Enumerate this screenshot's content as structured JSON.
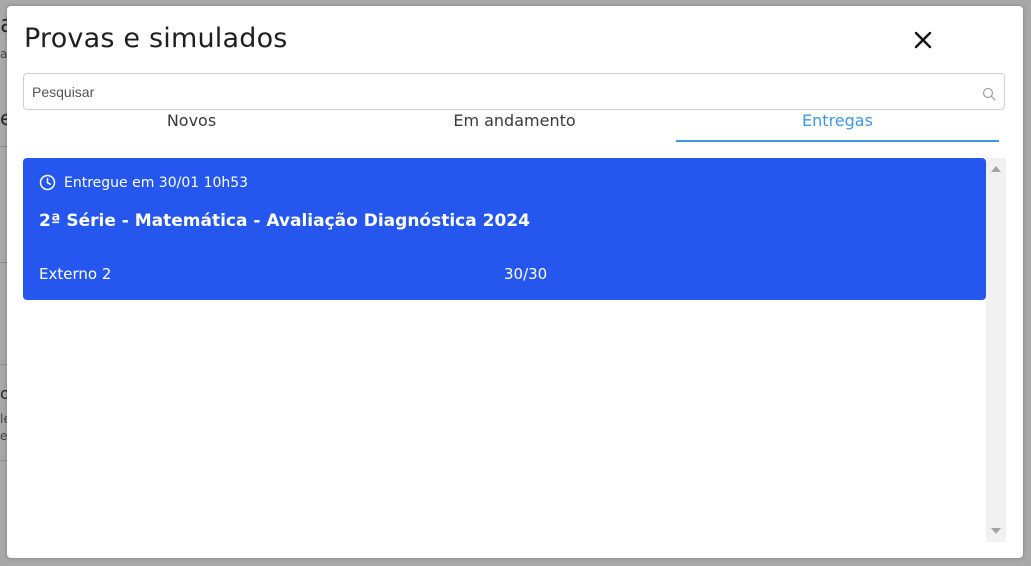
{
  "background": {
    "frag_big": "a",
    "frag_small1": "a",
    "frag_mid": "e",
    "frag_mid2": "o",
    "frag_s2": "le",
    "frag_s3": "e"
  },
  "modal": {
    "title": "Provas e simulados",
    "close_icon": "close-icon"
  },
  "search": {
    "placeholder": "Pesquisar",
    "value": "",
    "icon": "search-icon"
  },
  "tabs": [
    {
      "label": "Novos",
      "active": false
    },
    {
      "label": "Em andamento",
      "active": false
    },
    {
      "label": "Entregas",
      "active": true
    }
  ],
  "colors": {
    "accent": "#3e96e6",
    "card": "#2557ee"
  },
  "deliveries": [
    {
      "date_label": "Entregue em 30/01 10h53",
      "title": "2ª Série - Matemática - Avaliação Diagnóstica 2024",
      "school": "Externo 2",
      "score": "30/30",
      "icon": "clock-icon"
    }
  ]
}
